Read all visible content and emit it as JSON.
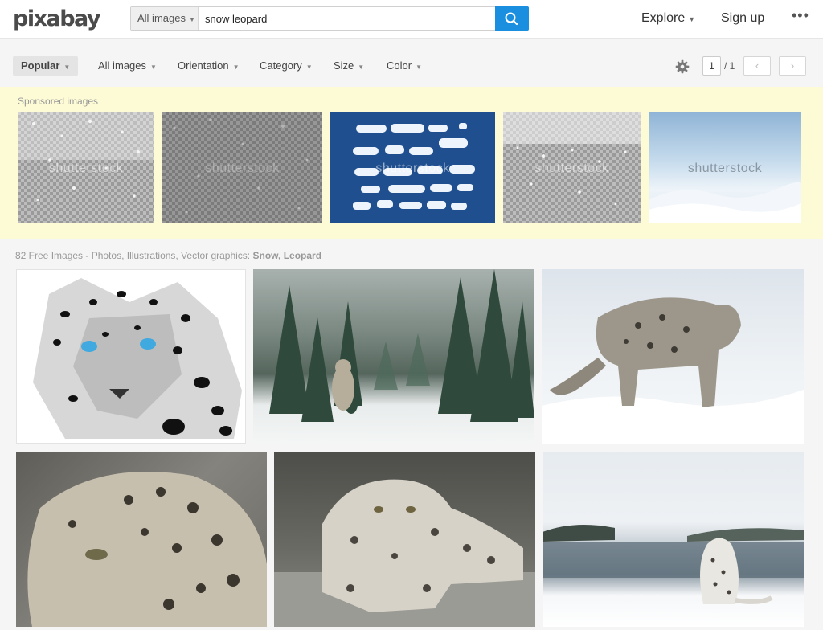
{
  "header": {
    "logo": "pixabay",
    "search_type": "All images",
    "search_value": "snow leopard",
    "nav_explore": "Explore",
    "nav_signup": "Sign up",
    "nav_more": "•••"
  },
  "filters": {
    "items": [
      "Popular",
      "All images",
      "Orientation",
      "Category",
      "Size",
      "Color"
    ],
    "page_current": "1",
    "page_total": "/ 1",
    "prev": "‹",
    "next": "›"
  },
  "sponsored": {
    "label": "Sponsored images",
    "watermark": "shutterstock"
  },
  "results": {
    "label": "82 Free Images - Photos, Illustrations, Vector graphics:",
    "terms": "Snow, Leopard"
  },
  "colors": {
    "accent": "#1a8fe0",
    "sponsored_bg": "#fdfbd6"
  }
}
